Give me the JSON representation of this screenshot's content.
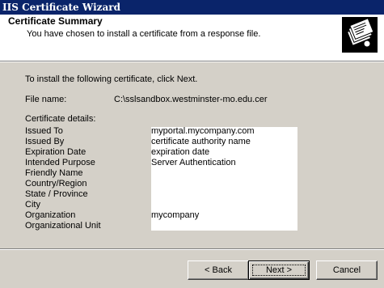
{
  "window": {
    "title": "IIS Certificate Wizard"
  },
  "header": {
    "title": "Certificate Summary",
    "description": "You have chosen to install a certificate from a response file.",
    "icon": "certificate-stack-icon"
  },
  "main": {
    "instruction": "To install the following certificate, click Next.",
    "file_name_label": "File name:",
    "file_name_value": "C:\\sslsandbox.westminster-mo.edu.cer",
    "details_label": "Certificate details:",
    "details": [
      {
        "label": "Issued To",
        "value": "myportal.mycompany.com"
      },
      {
        "label": "Issued By",
        "value": "certificate authority name"
      },
      {
        "label": "Expiration Date",
        "value": "expiration date"
      },
      {
        "label": "Intended Purpose",
        "value": "Server Authentication"
      },
      {
        "label": "Friendly Name",
        "value": ""
      },
      {
        "label": "Country/Region",
        "value": ""
      },
      {
        "label": "State / Province",
        "value": ""
      },
      {
        "label": "City",
        "value": ""
      },
      {
        "label": "Organization",
        "value": "mycompany"
      },
      {
        "label": "Organizational Unit",
        "value": ""
      }
    ]
  },
  "buttons": {
    "back_label": "< Back",
    "next_label": "Next >",
    "cancel_label": "Cancel"
  },
  "colors": {
    "titlebar": "#0a246a",
    "dialog_face": "#d4d0c8",
    "header_bg": "#ffffff"
  }
}
